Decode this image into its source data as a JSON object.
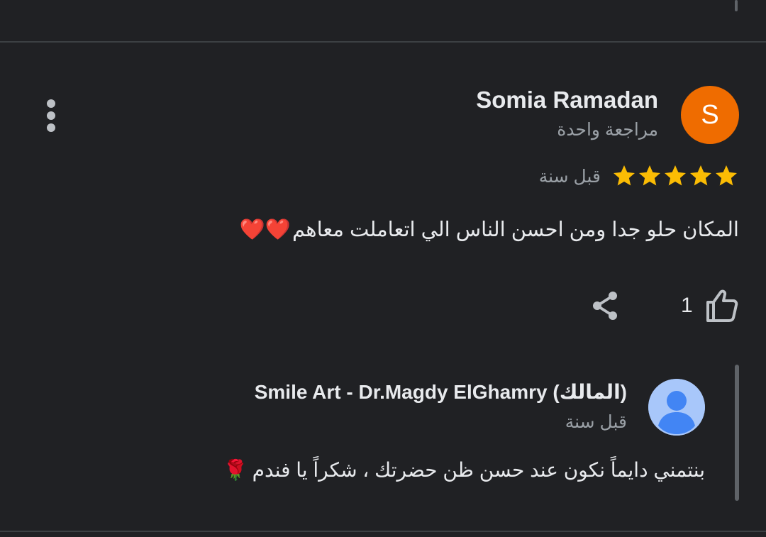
{
  "review": {
    "avatar_letter": "S",
    "avatar_color": "#ef6c00",
    "reviewer_name": "Somia Ramadan",
    "reviewer_meta": "مراجعة واحدة",
    "rating": 5,
    "rating_max": 5,
    "star_color": "#fbbc04",
    "time": "قبل سنة",
    "text": "المكان حلو جدا ومن احسن الناس الي اتعاملت معاهم",
    "emoji": "❤️❤️",
    "like_count": "1",
    "icons": {
      "menu": "more-vert-icon",
      "like": "thumb-up-icon",
      "share": "share-icon"
    }
  },
  "owner_reply": {
    "name": "Smile Art - Dr.Magdy ElGhamry (المالك)",
    "time": "قبل سنة",
    "text": "بنتمني دايماً نكون عند حسن ظن حضرتك ، شكراً يا فندم",
    "emoji": "🌹",
    "avatar_icon": "person-avatar-icon",
    "avatar_color": "#a8c7fa"
  }
}
